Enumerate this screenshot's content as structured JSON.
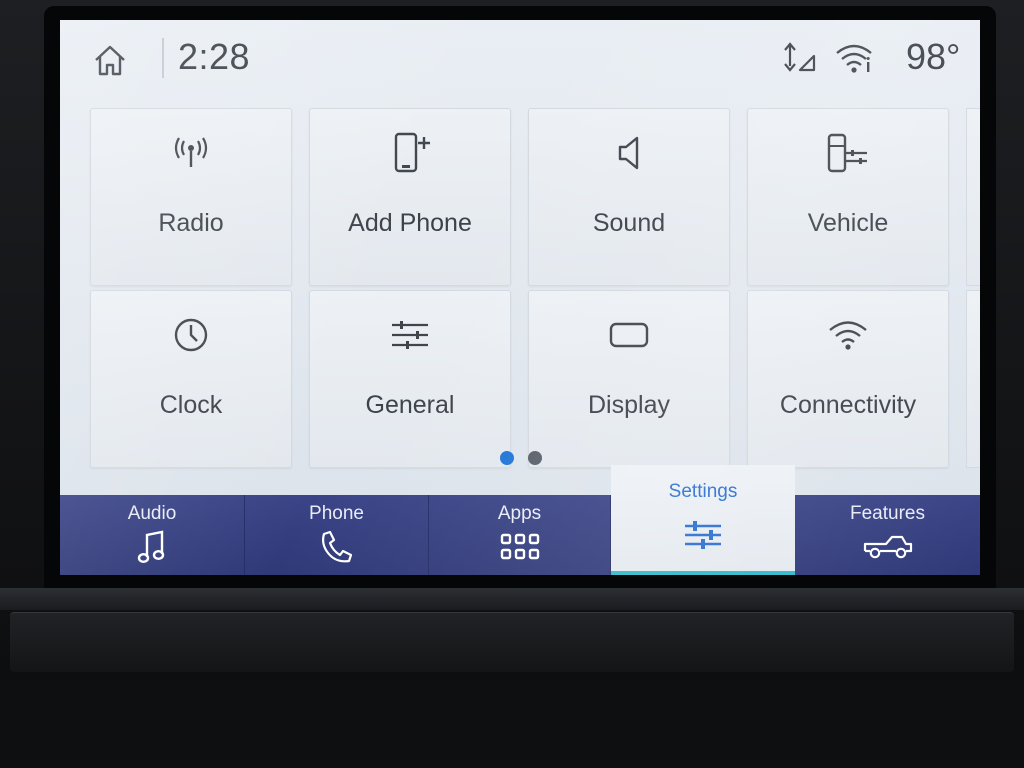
{
  "status_bar": {
    "time": "2:28",
    "temperature": "98°"
  },
  "tiles_row1": [
    {
      "label": "Radio",
      "icon": "radio-antenna-icon"
    },
    {
      "label": "Add Phone",
      "icon": "add-phone-icon"
    },
    {
      "label": "Sound",
      "icon": "speaker-icon"
    },
    {
      "label": "Vehicle",
      "icon": "vehicle-settings-icon"
    }
  ],
  "tiles_row2": [
    {
      "label": "Clock",
      "icon": "clock-icon"
    },
    {
      "label": "General",
      "icon": "sliders-icon"
    },
    {
      "label": "Display",
      "icon": "display-icon"
    },
    {
      "label": "Connectivity",
      "icon": "wifi-icon"
    }
  ],
  "pager": {
    "pages": 2,
    "current": 1
  },
  "bottom_nav": [
    {
      "label": "Audio",
      "icon": "music-note-icon",
      "active": false
    },
    {
      "label": "Phone",
      "icon": "phone-handset-icon",
      "active": false
    },
    {
      "label": "Apps",
      "icon": "apps-grid-icon",
      "active": false
    },
    {
      "label": "Settings",
      "icon": "settings-sliders-icon",
      "active": true
    },
    {
      "label": "Features",
      "icon": "truck-icon",
      "active": false
    }
  ],
  "colors": {
    "accent_blue": "#2b6fcf",
    "nav_background": "#34407f",
    "active_underline": "#2fb8c9",
    "pager_active": "#1f74d6",
    "pager_inactive": "#59606a"
  }
}
